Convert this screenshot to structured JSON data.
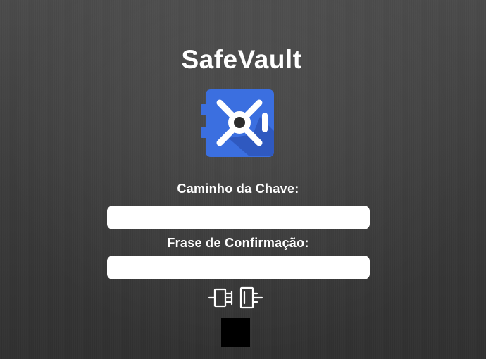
{
  "app": {
    "title": "SafeVault",
    "logo_icon": "vault-safe-icon",
    "brand_color": "#3b6fe0"
  },
  "form": {
    "key_path_label": "Caminho da Chave:",
    "key_path_value": "",
    "key_path_placeholder": "",
    "passphrase_label": "Frase de Confirmação:",
    "passphrase_value": "",
    "passphrase_placeholder": ""
  },
  "actions": {
    "connect_icon": "plug-connect-icon"
  },
  "status": {
    "indicator_color": "#000000"
  }
}
